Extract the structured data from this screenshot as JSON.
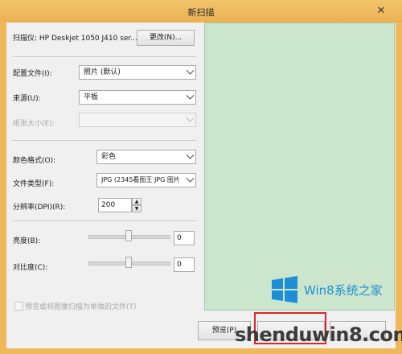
{
  "window": {
    "title": "新扫描",
    "close_glyph": "✕"
  },
  "scanner": {
    "label": "扫描仪: HP Deskjet 1050 J410 ser...",
    "change_button": "更改(N)..."
  },
  "profile": {
    "label": "配置文件(I):",
    "value": "照片 (默认)"
  },
  "source": {
    "label": "来源(U):",
    "value": "平板"
  },
  "paper_size": {
    "label": "纸张大小(E):",
    "value": ""
  },
  "color_format": {
    "label": "颜色格式(O):",
    "value": "彩色"
  },
  "file_type": {
    "label": "文件类型(F):",
    "value": "JPG (2345看图王 JPG 图片"
  },
  "resolution": {
    "label": "分辨率(DPI)(R):",
    "value": "200"
  },
  "brightness": {
    "label": "亮度(B):",
    "value": "0",
    "level": 0.5
  },
  "contrast": {
    "label": "对比度(C):",
    "value": "0",
    "level": 0.5
  },
  "separate_files": {
    "label": "预览或将图像扫描为单独的文件(T)",
    "checked": false
  },
  "buttons": {
    "preview": "预览(P)"
  },
  "watermark": {
    "logo_text": "Win8系统之家",
    "site": "shenduwin8.com",
    "logo_color": "#1e8fd6",
    "highlight_color": "#e0242b"
  },
  "colors": {
    "title_bar": "#efb85a",
    "preview_bg": "#cbe6cc"
  }
}
